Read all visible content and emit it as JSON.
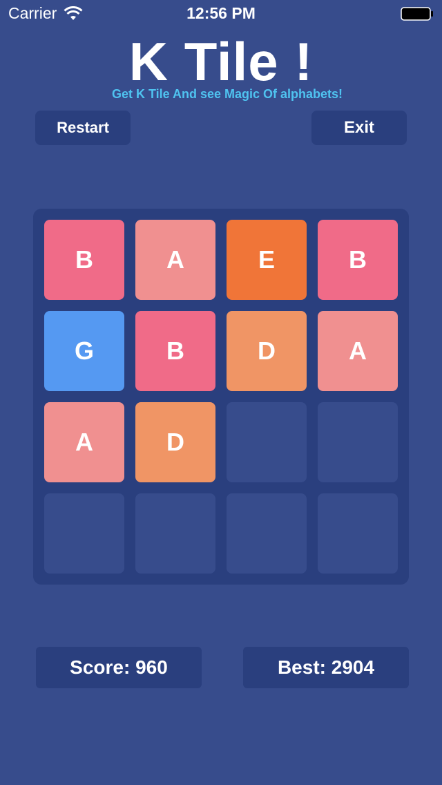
{
  "status_bar": {
    "carrier": "Carrier",
    "time": "12:56 PM"
  },
  "header": {
    "title": "K Tile !",
    "subtitle": "Get K Tile And see Magic Of alphabets!"
  },
  "buttons": {
    "restart_label": "Restart",
    "exit_label": "Exit"
  },
  "colors": {
    "background": "#374C8C",
    "panel": "#2A3F7E",
    "subtitle": "#4FC3F0",
    "A": "#F09090",
    "B": "#F06B88",
    "D": "#F09565",
    "E": "#F07538",
    "G": "#5599F2"
  },
  "board": {
    "size": 4,
    "rows": [
      [
        "B",
        "A",
        "E",
        "B"
      ],
      [
        "G",
        "B",
        "D",
        "A"
      ],
      [
        "A",
        "D",
        "",
        ""
      ],
      [
        "",
        "",
        "",
        ""
      ]
    ]
  },
  "scores": {
    "score_text": "Score: 960",
    "best_text": "Best: 2904"
  }
}
